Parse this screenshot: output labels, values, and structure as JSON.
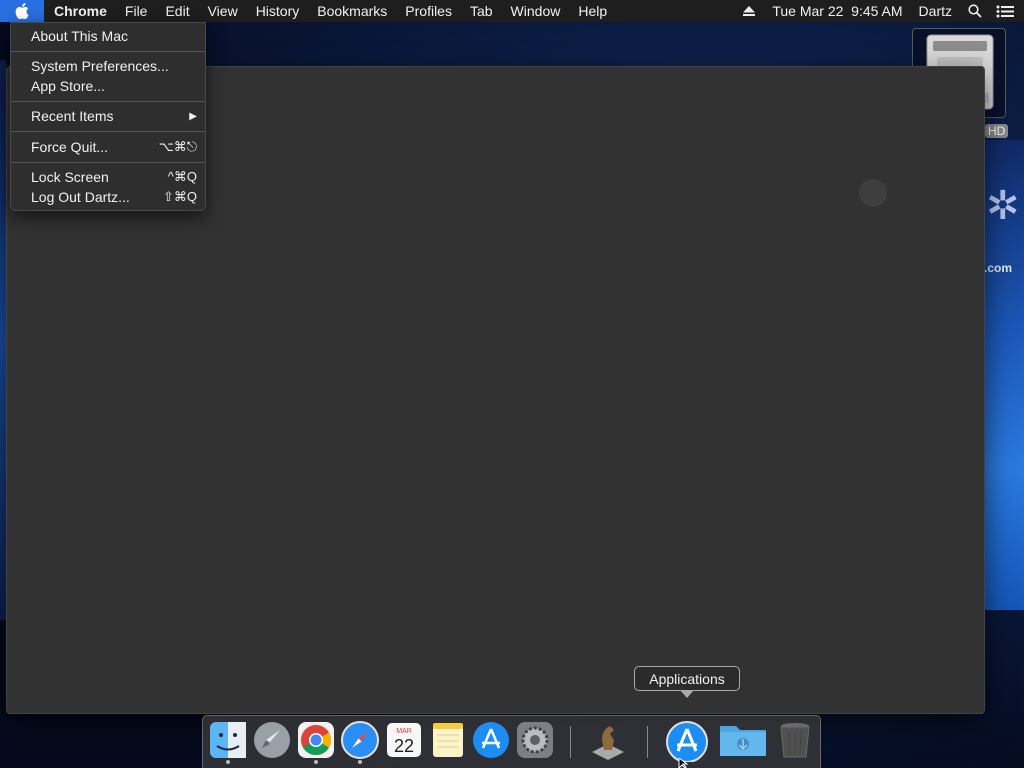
{
  "menubar": {
    "apple_icon": "apple-logo-icon",
    "app_name": "Chrome",
    "items": [
      "File",
      "Edit",
      "View",
      "History",
      "Bookmarks",
      "Profiles",
      "Tab",
      "Window",
      "Help"
    ],
    "datetime": "Tue Mar 22  9:45 AM",
    "user": "Dartz",
    "icons": [
      "eject-icon",
      "spotlight-search-icon",
      "notification-center-icon"
    ]
  },
  "apple_menu": {
    "about": "About This Mac",
    "system_prefs": "System Preferences...",
    "app_store": "App Store...",
    "recent_items": "Recent Items",
    "force_quit": "Force Quit...",
    "force_quit_shortcut": "⌥⌘⎋",
    "lock_screen": "Lock Screen",
    "lock_screen_shortcut": "^⌘Q",
    "log_out": "Log Out Dartz...",
    "log_out_shortcut": "⇧⌘Q"
  },
  "desktop": {
    "hd_label": "HD",
    "wallpaper_text": ".com"
  },
  "tooltip": "Applications",
  "dock": {
    "calendar_month": "MAR",
    "calendar_day": "22",
    "items": [
      "Finder",
      "Launchpad",
      "Google Chrome",
      "Safari",
      "Calendar",
      "Notes",
      "App Store",
      "System Preferences",
      "Chess",
      "Applications",
      "Downloads",
      "Trash"
    ]
  },
  "colors": {
    "menubar_bg": "#1e1e1e",
    "apple_highlight": "#2a6fe0",
    "window_bg": "#323232",
    "menu_bg": "#2e2e2e"
  }
}
